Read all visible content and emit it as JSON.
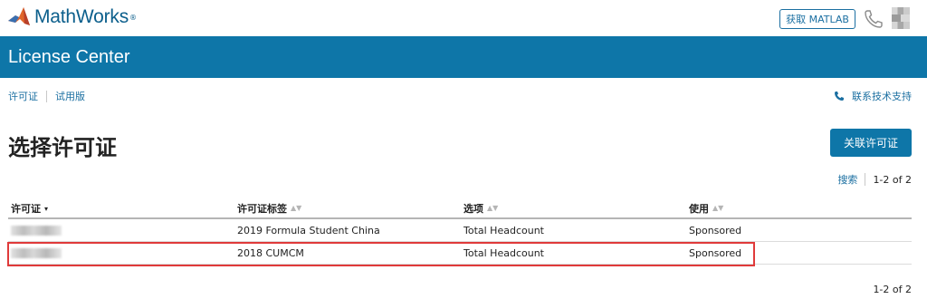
{
  "header": {
    "brand": "MathWorks",
    "registered": "®",
    "get_matlab": "获取 MATLAB",
    "phone_icon": "phone-icon",
    "avatar_icon": "user-avatar"
  },
  "banner": {
    "title": "License Center"
  },
  "subnav": {
    "items": [
      {
        "label": "许可证"
      },
      {
        "label": "试用版"
      }
    ],
    "support_label": "联系技术支持"
  },
  "page": {
    "title": "选择许可证",
    "link_button": "关联许可证"
  },
  "pager_top": {
    "search_label": "搜索",
    "count": "1-2 of 2"
  },
  "table": {
    "columns": [
      {
        "label": "许可证",
        "sort": "▾"
      },
      {
        "label": "许可证标签",
        "sort": "▲▼"
      },
      {
        "label": "选项",
        "sort": "▲▼"
      },
      {
        "label": "使用",
        "sort": "▲▼"
      }
    ],
    "rows": [
      {
        "license": "",
        "label": "2019 Formula Student China",
        "option": "Total Headcount",
        "use": "Sponsored"
      },
      {
        "license": "",
        "label": "2018 CUMCM",
        "option": "Total Headcount",
        "use": "Sponsored"
      }
    ]
  },
  "pager_bottom": {
    "count": "1-2 of 2"
  },
  "colors": {
    "brand_blue": "#0e76a8",
    "link_blue": "#1b6fa1",
    "highlight_red": "#e03a3a"
  }
}
